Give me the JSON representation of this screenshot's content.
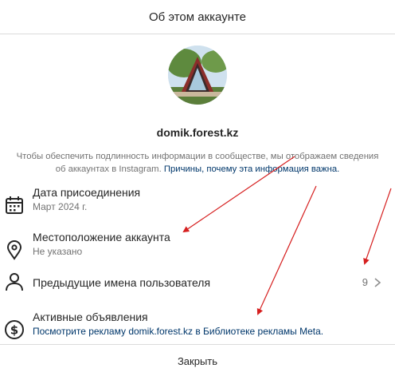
{
  "header": {
    "title": "Об этом аккаунте"
  },
  "profile": {
    "username": "domik.forest.kz"
  },
  "info": {
    "text": "Чтобы обеспечить подлинность информации в сообществе, мы отображаем сведения об аккаунтах в Instagram.",
    "link": "Причины, почему эта информация важна."
  },
  "rows": [
    {
      "title": "Дата присоединения",
      "value": "Март 2024 г.",
      "icon": "calendar-icon"
    },
    {
      "title": "Местоположение аккаунта",
      "value": "Не указано",
      "icon": "location-pin-icon"
    },
    {
      "title": "Предыдущие имена пользователя",
      "count": "9",
      "icon": "user-icon"
    },
    {
      "title": "Активные объявления",
      "value": "Посмотрите рекламу domik.forest.kz в Библиотеке рекламы Meta.",
      "icon": "dollar-coin-icon"
    }
  ],
  "footer": {
    "close_label": "Закрыть"
  },
  "colors": {
    "annotation_arrows": "#d62020",
    "link": "#00376b"
  }
}
